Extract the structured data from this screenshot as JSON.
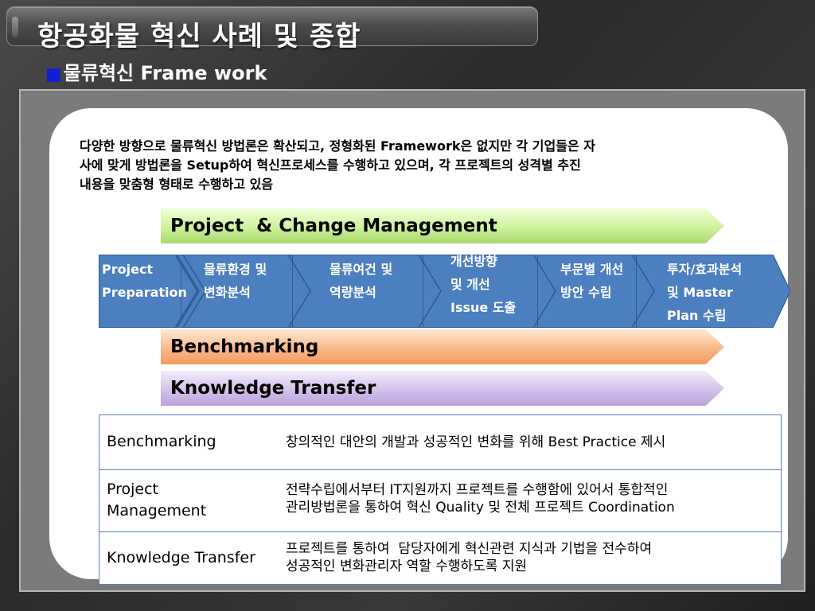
{
  "slide": {
    "title": "항공화물 혁신 사례 및 종합",
    "subtitle_bullet": "■",
    "subtitle": "물류혁신 Frame work"
  },
  "intro": {
    "line1": "다양한 방향으로 물류혁신 방법론은 확산되고, 정형화된 Framework은 없지만 각 기업들은 자",
    "line2": "사에 맞게 방법론을 Setup하여 혁신프로세스를 수행하고 있으며, 각 프로젝트의 성격별 추진",
    "line3": "내용을 맞춤형 형태로 수행하고 있음"
  },
  "bars": {
    "pcm": "Project  & Change Management",
    "benchmarking": "Benchmarking",
    "knowledge": "Knowledge Transfer"
  },
  "process": {
    "steps": [
      {
        "line1": "Project",
        "line2": "Preparation",
        "line3": ""
      },
      {
        "line1": "물류환경 및",
        "line2": "변화분석",
        "line3": ""
      },
      {
        "line1": "물류여건 및",
        "line2": "역량분석",
        "line3": ""
      },
      {
        "line1": "개선방향",
        "line2": "및 개선",
        "line3": "Issue 도출"
      },
      {
        "line1": "부문별 개선",
        "line2": "방안 수립",
        "line3": ""
      },
      {
        "line1": "투자/효과분석",
        "line2": "및 Master",
        "line3": "Plan 수립"
      }
    ]
  },
  "table": {
    "rows": [
      {
        "term1": "Benchmarking",
        "term2": "",
        "desc1": "창의적인 대안의 개발과 성공적인 변화를 위해 Best Practice 제시",
        "desc2": ""
      },
      {
        "term1": "Project",
        "term2": "Management",
        "desc1": "전략수립에서부터 IT지원까지 프로젝트를 수행함에 있어서 통합적인",
        "desc2": "관리방법론을 통하여 혁신 Quality 및 전체 프로젝트 Coordination"
      },
      {
        "term1": "Knowledge Transfer",
        "term2": "",
        "desc1": "프로젝트를 통하여  담당자에게 혁신관련 지식과 기법을 전수하여",
        "desc2": "성공적인 변화관리자 역할 수행하도록 지원"
      }
    ]
  },
  "colors": {
    "process_blue": "#4c7fbf",
    "pcm_green": "#cdf29b",
    "bench_orange": "#f9b98a",
    "kt_purple": "#d3c1ea",
    "bullet_blue": "#1020d0"
  }
}
